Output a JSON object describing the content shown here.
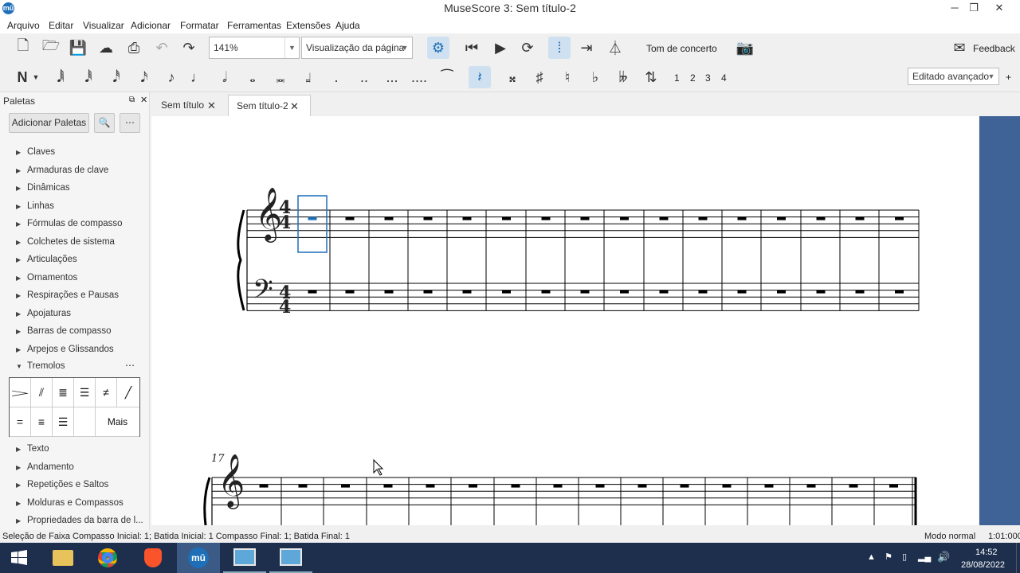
{
  "window": {
    "title": "MuseScore 3: Sem título-2",
    "app_icon": "mū"
  },
  "menu": [
    "Arquivo",
    "Editar",
    "Visualizar",
    "Adicionar",
    "Formatar",
    "Ferramentas",
    "Extensões",
    "Ajuda"
  ],
  "toolbar": {
    "zoom": "141%",
    "view_mode": "Visualização da página",
    "concert_pitch": "Tom de concerto",
    "feedback": "Feedback"
  },
  "note_toolbar": {
    "voices": [
      "1",
      "2",
      "3",
      "4"
    ],
    "workspace": "Editado avançado",
    "plus": "+"
  },
  "palettes": {
    "title": "Paletas",
    "add_button": "Adicionar Paletas",
    "more": "⋯",
    "items_top": [
      "Claves",
      "Armaduras de clave",
      "Dinâmicas",
      "Linhas",
      "Fórmulas de compasso",
      "Colchetes de sistema",
      "Articulações",
      "Ornamentos",
      "Respirações e Pausas",
      "Apojaturas",
      "Barras de compasso",
      "Arpejos e Glissandos"
    ],
    "expanded": "Tremolos",
    "more_cell": "Mais",
    "items_bottom": [
      "Texto",
      "Andamento",
      "Repetições e Saltos",
      "Molduras e Compassos",
      "Propriedades da barra de l..."
    ]
  },
  "tabs": [
    {
      "label": "Sem título"
    },
    {
      "label": "Sem título-2"
    }
  ],
  "score": {
    "measure_number": "17",
    "time_top": "4",
    "time_bottom": "4"
  },
  "status": {
    "selection": "Seleção de Faixa Compasso Inicial: 1; Batida Inicial: 1 Compasso Final: 1; Batida Final: 1",
    "mode": "Modo normal",
    "time": "1:01:000"
  },
  "taskbar": {
    "clock_time": "14:52",
    "clock_date": "28/08/2022"
  },
  "colors": {
    "accent": "#1e6fb8",
    "sidebar_right": "#3f6397",
    "taskbar": "#1d2f4d"
  }
}
